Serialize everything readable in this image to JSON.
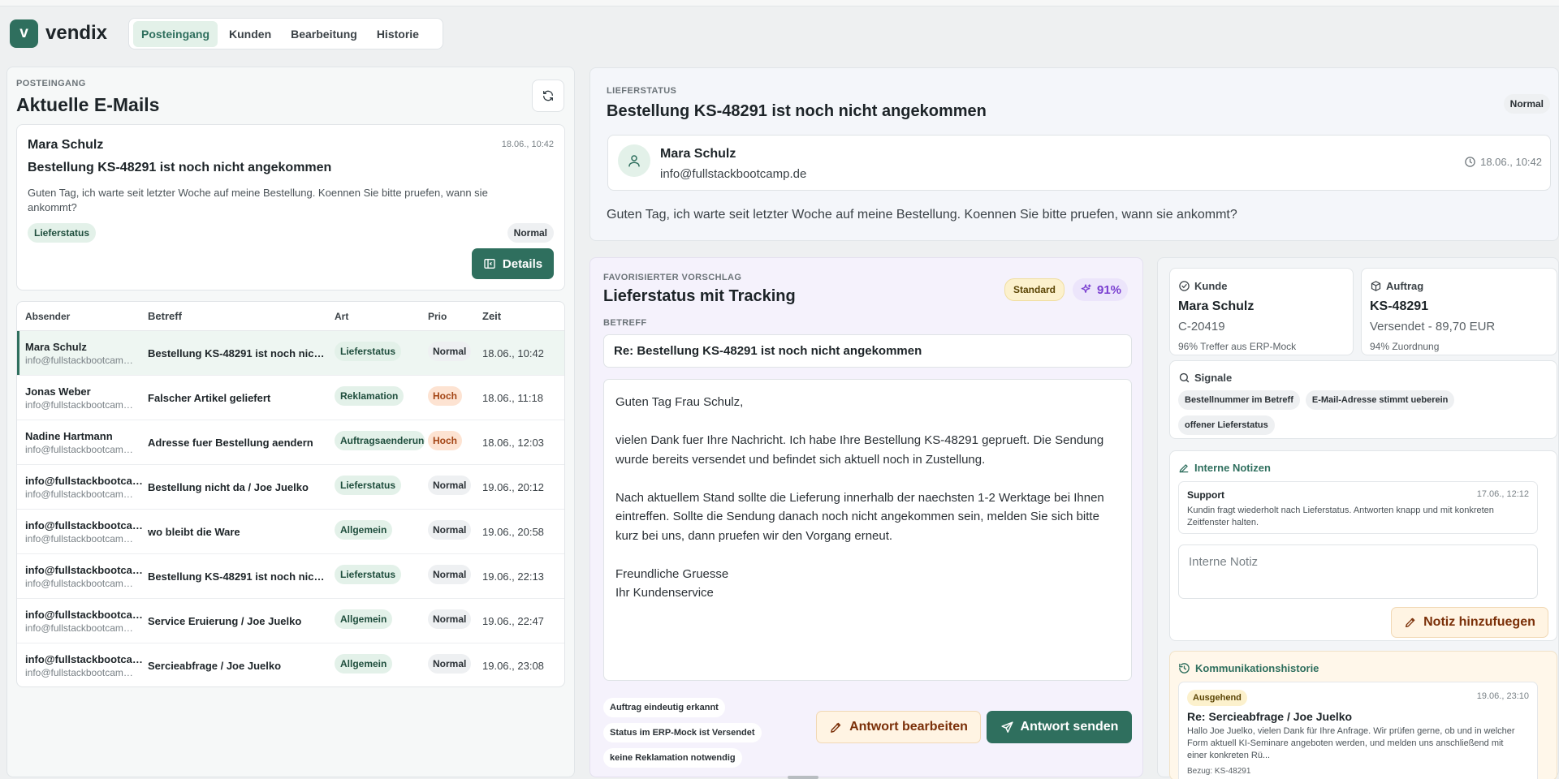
{
  "app": {
    "brand": "vendix",
    "logo_letter": "v"
  },
  "nav": {
    "tabs": [
      {
        "label": "Posteingang",
        "active": true
      },
      {
        "label": "Kunden"
      },
      {
        "label": "Bearbeitung"
      },
      {
        "label": "Historie"
      }
    ]
  },
  "inbox": {
    "kicker": "POSTEINGANG",
    "title": "Aktuelle E-Mails",
    "preview": {
      "name": "Mara Schulz",
      "time": "18.06., 10:42",
      "subject": "Bestellung KS-48291 ist noch nicht angekommen",
      "text": "Guten Tag, ich warte seit letzter Woche auf meine Bestellung. Koennen Sie bitte pruefen, wann sie ankommt?",
      "tag": "Lieferstatus",
      "prio": "Normal",
      "details_label": "Details"
    },
    "columns": [
      "Absender",
      "Betreff",
      "Art",
      "Prio",
      "Zeit"
    ],
    "rows": [
      {
        "name": "Mara Schulz",
        "email": "info@fullstackbootcamp.de",
        "subject": "Bestellung KS-48291 ist noch nicht angekommen",
        "type": "Lieferstatus",
        "prio": "Normal",
        "time": "18.06., 10:42"
      },
      {
        "name": "Jonas Weber",
        "email": "info@fullstackbootcamp.de",
        "subject": "Falscher Artikel geliefert",
        "type": "Reklamation",
        "prio": "Hoch",
        "time": "18.06., 11:18"
      },
      {
        "name": "Nadine Hartmann",
        "email": "info@fullstackbootcamp.de",
        "subject": "Adresse fuer Bestellung aendern",
        "type": "Auftragsaenderung",
        "prio": "Hoch",
        "time": "18.06., 12:03"
      },
      {
        "name": "info@fullstackbootcamp.de",
        "email": "info@fullstackbootcamp.de",
        "subject": "Bestellung nicht da / Joe Juelko",
        "type": "Lieferstatus",
        "prio": "Normal",
        "time": "19.06., 20:12"
      },
      {
        "name": "info@fullstackbootcamp.de",
        "email": "info@fullstackbootcamp.de",
        "subject": "wo bleibt die Ware",
        "type": "Allgemein",
        "prio": "Normal",
        "time": "19.06., 20:58"
      },
      {
        "name": "info@fullstackbootcamp.de",
        "email": "info@fullstackbootcamp.de",
        "subject": "Bestellung KS-48291 ist noch nicht angekommen",
        "type": "Lieferstatus",
        "prio": "Normal",
        "time": "19.06., 22:13"
      },
      {
        "name": "info@fullstackbootcamp.de",
        "email": "info@fullstackbootcamp.de",
        "subject": "Service Eruierung / Joe Juelko",
        "type": "Allgemein",
        "prio": "Normal",
        "time": "19.06., 22:47"
      },
      {
        "name": "info@fullstackbootcamp.de",
        "email": "info@fullstackbootcamp.de",
        "subject": "Sercieabfrage / Joe Juelko",
        "type": "Allgemein",
        "prio": "Normal",
        "time": "19.06., 23:08"
      }
    ]
  },
  "mail": {
    "kicker": "LIEFERSTATUS",
    "title": "Bestellung KS-48291 ist noch nicht angekommen",
    "prio": "Normal",
    "sender_name": "Mara Schulz",
    "sender_email": "info@fullstackbootcamp.de",
    "time": "18.06., 10:42",
    "body": "Guten Tag, ich warte seit letzter Woche auf meine Bestellung. Koennen Sie bitte pruefen, wann sie ankommt?"
  },
  "suggestion": {
    "kicker": "FAVORISIERTER VORSCHLAG",
    "title": "Lieferstatus mit Tracking",
    "badge": "Standard",
    "score": "91%",
    "subject_label": "BETREFF",
    "subject": "Re: Bestellung KS-48291 ist noch nicht angekommen",
    "body_lines": [
      "Guten Tag Frau Schulz,",
      "",
      "vielen Dank fuer Ihre Nachricht. Ich habe Ihre Bestellung KS-48291 geprueft. Die Sendung wurde bereits versendet und befindet sich aktuell noch in Zustellung.",
      "",
      "Nach aktuellem Stand sollte die Lieferung innerhalb der naechsten 1-2 Werktage bei Ihnen eintreffen. Sollte die Sendung danach noch nicht angekommen sein, melden Sie sich bitte kurz bei uns, dann pruefen wir den Vorgang erneut.",
      "",
      "Freundliche Gruesse",
      "Ihr Kundenservice"
    ],
    "checks": [
      "Auftrag eindeutig erkannt",
      "Status im ERP-Mock ist Versendet",
      "keine Reklamation notwendig"
    ],
    "edit_label": "Antwort bearbeiten",
    "send_label": "Antwort senden"
  },
  "customer": {
    "label": "Kunde",
    "name": "Mara Schulz",
    "id": "C-20419",
    "match": "96% Treffer aus ERP-Mock"
  },
  "order": {
    "label": "Auftrag",
    "id": "KS-48291",
    "status": "Versendet - 89,70 EUR",
    "match": "94% Zuordnung"
  },
  "signals": {
    "label": "Signale",
    "tags": [
      "Bestellnummer im Betreff",
      "E-Mail-Adresse stimmt ueberein",
      "offener Lieferstatus"
    ]
  },
  "notes": {
    "label": "Interne Notizen",
    "items": [
      {
        "author": "Support",
        "time": "17.06., 12:12",
        "text": "Kundin fragt wiederholt nach Lieferstatus. Antworten knapp und mit konkreten Zeitfenster halten."
      }
    ],
    "placeholder": "Interne Notiz",
    "add_label": "Notiz hinzufuegen"
  },
  "history": {
    "label": "Kommunikationshistorie",
    "items": [
      {
        "direction": "Ausgehend",
        "time": "19.06., 23:10",
        "subject": "Re: Sercieabfrage / Joe Juelko",
        "text": "Hallo Joe Juelko, vielen Dank für Ihre Anfrage. Wir prüfen gerne, ob und in welcher Form aktuell KI-Seminare angeboten werden, und melden uns anschließend mit einer konkreten Rü...",
        "ref": "Bezug: KS-48291"
      }
    ]
  },
  "colors": {
    "accent": "#2f6f5e",
    "high_prio": "#a34414",
    "score": "#7a3fd0"
  }
}
